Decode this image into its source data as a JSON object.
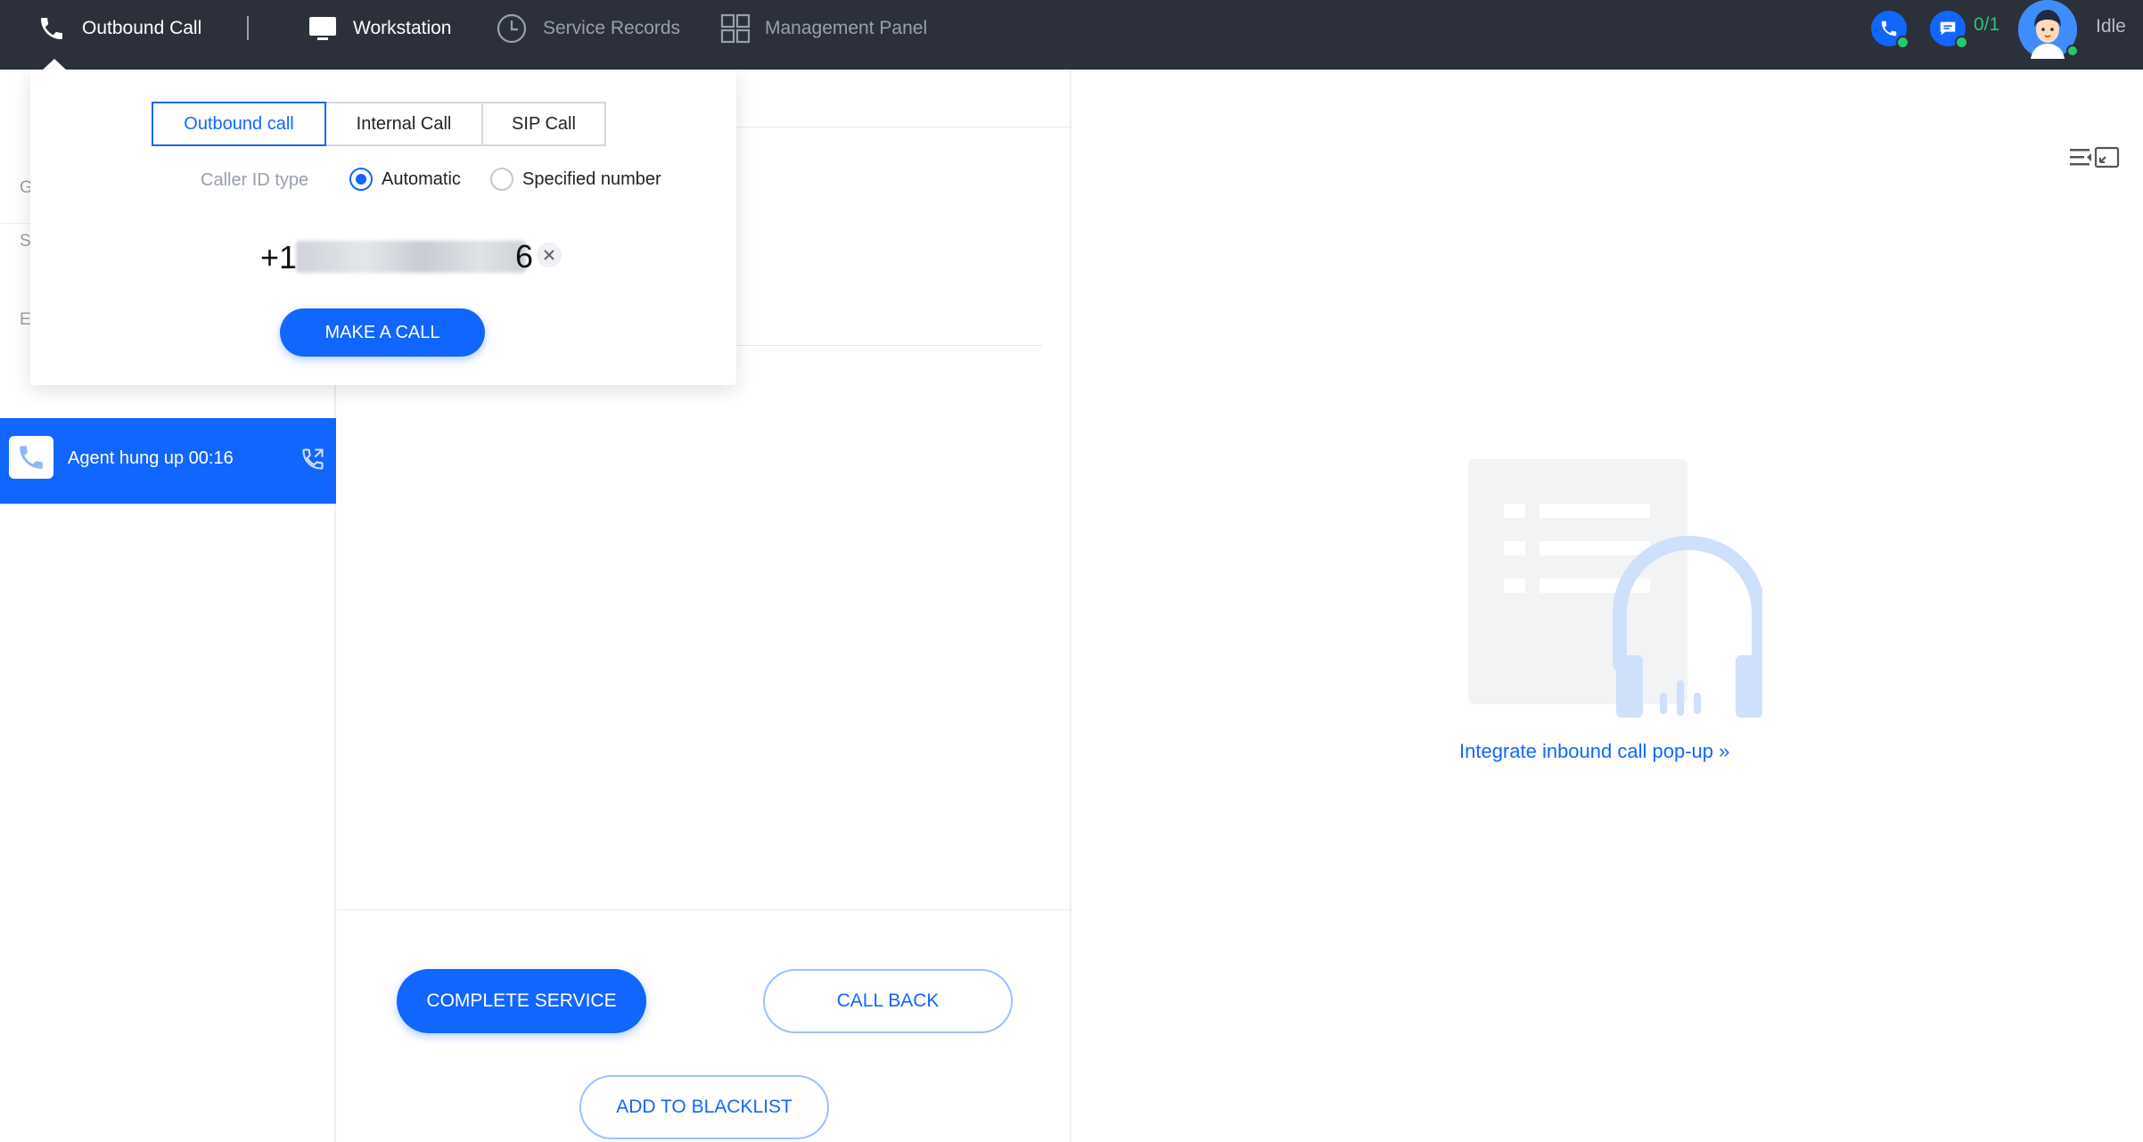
{
  "topbar": {
    "outbound_call": "Outbound Call",
    "workstation": "Workstation",
    "service_records": "Service Records",
    "management_panel": "Management Panel",
    "session_count": "0/1",
    "agent_status": "Idle",
    "icons": {
      "outbound_call": "phone-icon",
      "workstation": "monitor-icon",
      "service_records": "clock-icon",
      "management_panel": "grid-icon",
      "phone_status": "phone-status-icon",
      "chat_status": "chat-status-icon"
    },
    "colors": {
      "background": "#2b303b",
      "online": "#28c76f",
      "accent": "#1166ff"
    }
  },
  "left_panel": {
    "ghost_letters": [
      "G",
      "S",
      "E"
    ],
    "call_item": {
      "label": "Agent hung up 00:16"
    }
  },
  "dialer": {
    "tabs": [
      "Outbound call",
      "Internal Call",
      "SIP Call"
    ],
    "active_tab": "Outbound call",
    "caller_id_label": "Caller ID type",
    "caller_id_options": [
      "Automatic",
      "Specified number"
    ],
    "caller_id_selected": "Automatic",
    "phone_value": "+1",
    "phone_last_digit": "6",
    "make_call_label": "MAKE A CALL"
  },
  "actions": {
    "complete_service": "COMPLETE SERVICE",
    "call_back": "CALL BACK",
    "add_to_blacklist": "ADD TO BLACKLIST"
  },
  "right_panel": {
    "integrate_link": "Integrate inbound call pop-up »"
  }
}
